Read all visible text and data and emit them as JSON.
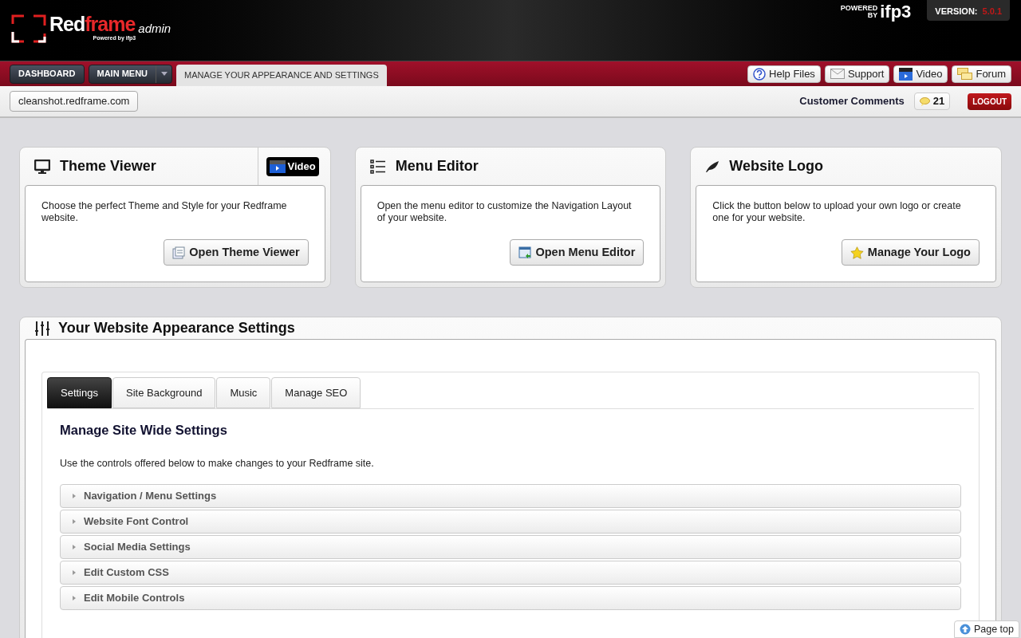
{
  "header": {
    "logo": {
      "part_1": "Red",
      "part_2": "frame",
      "suffix": "admin",
      "tagline": "Powered by ifp3"
    },
    "powered_by": {
      "label_1": "POWERED",
      "label_2": "BY",
      "brand": "ifp3"
    },
    "version": {
      "label": "VERSION:",
      "value": "5.0.1"
    }
  },
  "nav": {
    "buttons": [
      {
        "label": "DASHBOARD",
        "has_dropdown": false
      },
      {
        "label": "MAIN MENU",
        "has_dropdown": true
      }
    ],
    "current_page": "MANAGE YOUR APPEARANCE AND SETTINGS",
    "links": [
      {
        "label": "Help Files",
        "kind": "help"
      },
      {
        "label": "Support",
        "kind": "mail"
      },
      {
        "label": "Video",
        "kind": "video"
      },
      {
        "label": "Forum",
        "kind": "forum"
      }
    ]
  },
  "subbar": {
    "site": "cleanshot.redframe.com",
    "comments_label": "Customer Comments",
    "comments_count": "21",
    "logout": "LOGOUT"
  },
  "cards": [
    {
      "kind": "monitor",
      "title": "Theme Viewer",
      "video_button": "Video",
      "text": "Choose the perfect Theme and Style for your Redframe website.",
      "button": "Open Theme Viewer"
    },
    {
      "kind": "list",
      "title": "Menu Editor",
      "text": "Open the menu editor to customize the Navigation Layout of your website.",
      "button": "Open Menu Editor"
    },
    {
      "kind": "leaf",
      "title": "Website Logo",
      "text": "Click the button below to upload your own logo or create one for your website.",
      "button": "Manage Your Logo"
    }
  ],
  "settings_panel": {
    "title": "Your Website Appearance Settings",
    "tabs": [
      {
        "label": "Settings",
        "selected": true
      },
      {
        "label": "Site Background",
        "selected": false
      },
      {
        "label": "Music",
        "selected": false
      },
      {
        "label": "Manage SEO",
        "selected": false
      }
    ],
    "heading": "Manage Site Wide Settings",
    "description": "Use the controls offered below to make changes to your Redframe site.",
    "sections": [
      {
        "label": "Navigation / Menu Settings",
        "expanded": false
      },
      {
        "label": "Website Font Control",
        "expanded": false
      },
      {
        "label": "Social Media Settings",
        "expanded": false
      },
      {
        "label": "Edit Custom CSS",
        "expanded": false
      },
      {
        "label": "Edit Mobile Controls",
        "expanded": false
      }
    ]
  },
  "page_top": "Page top"
}
